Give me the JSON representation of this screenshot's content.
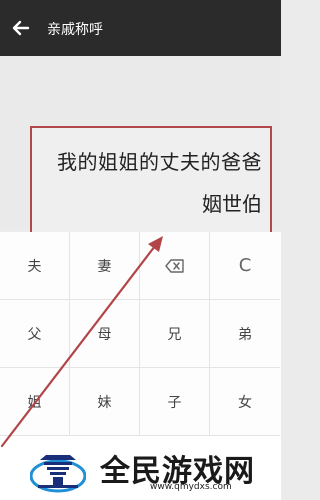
{
  "header": {
    "title": "亲戚称呼"
  },
  "callout": {
    "expression": "我的姐姐的丈夫的爸爸",
    "result": "姻世伯"
  },
  "keypad": {
    "row1": [
      "夫",
      "妻",
      "",
      "C"
    ],
    "row2": [
      "父",
      "母",
      "兄",
      "弟"
    ],
    "row3": [
      "姐",
      "妹",
      "子",
      "女"
    ]
  },
  "watermark": {
    "brand": "全民游戏网",
    "url": "www.qmydxs.com"
  },
  "colors": {
    "topbar": "#2b2b2b",
    "callout_border": "#b1484a",
    "arrow": "#b14547"
  },
  "icons": {
    "back": "arrow-left-icon",
    "backspace": "backspace-icon",
    "logo": "temple-logo-icon"
  }
}
